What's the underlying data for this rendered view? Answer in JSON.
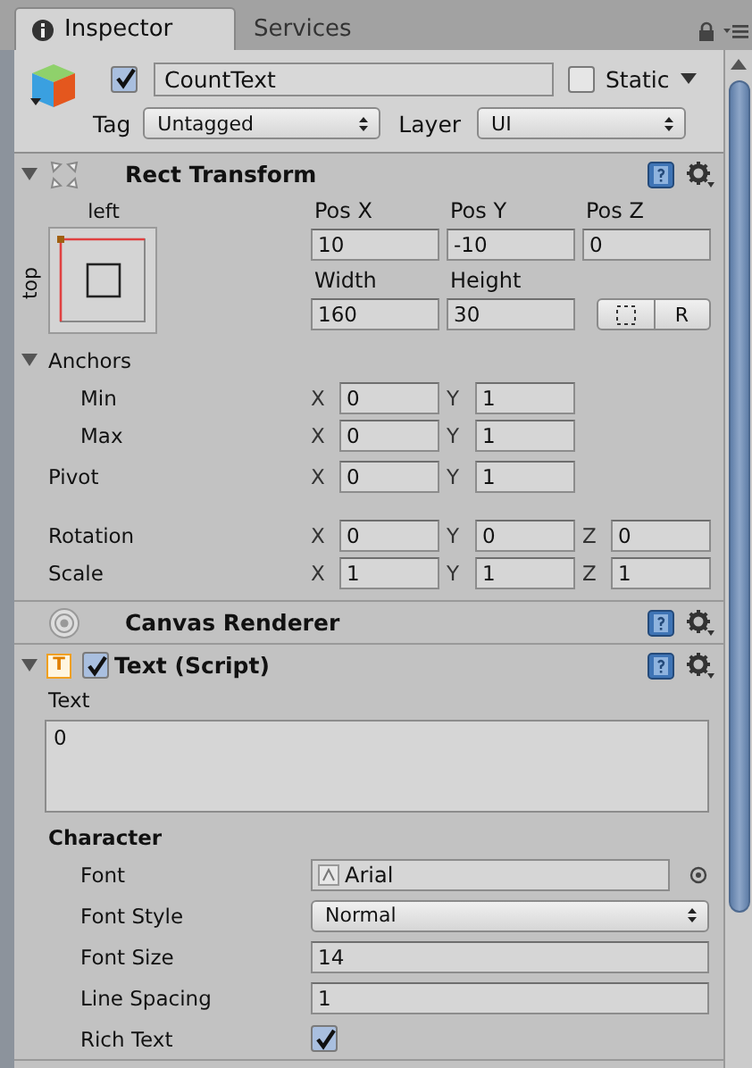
{
  "tabs": [
    {
      "label": "Inspector",
      "selected": true
    },
    {
      "label": "Services",
      "selected": false
    }
  ],
  "object": {
    "active": true,
    "name": "CountText",
    "static": false,
    "static_label": "Static",
    "tag_label": "Tag",
    "tag": "Untagged",
    "layer_label": "Layer",
    "layer": "UI"
  },
  "components": [
    {
      "kind": "rect_transform",
      "title": "Rect Transform",
      "expanded": true,
      "anchor_h": "left",
      "anchor_v": "top",
      "position_fields": [
        {
          "label": "Pos X",
          "value": "10"
        },
        {
          "label": "Pos Y",
          "value": "-10"
        },
        {
          "label": "Pos Z",
          "value": "0"
        }
      ],
      "size_fields": [
        {
          "label": "Width",
          "value": "160"
        },
        {
          "label": "Height",
          "value": "30"
        }
      ],
      "raw_button": "R",
      "anchors": {
        "label": "Anchors",
        "expanded": true,
        "rows": [
          {
            "label": "Min",
            "axes": [
              {
                "axis": "X",
                "value": "0"
              },
              {
                "axis": "Y",
                "value": "1"
              }
            ]
          },
          {
            "label": "Max",
            "axes": [
              {
                "axis": "X",
                "value": "0"
              },
              {
                "axis": "Y",
                "value": "1"
              }
            ]
          }
        ]
      },
      "groups": [
        {
          "rows": [
            {
              "label": "Pivot",
              "axes": [
                {
                  "axis": "X",
                  "value": "0"
                },
                {
                  "axis": "Y",
                  "value": "1"
                }
              ]
            }
          ]
        },
        {
          "rows": [
            {
              "label": "Rotation",
              "axes": [
                {
                  "axis": "X",
                  "value": "0"
                },
                {
                  "axis": "Y",
                  "value": "0"
                },
                {
                  "axis": "Z",
                  "value": "0"
                }
              ]
            },
            {
              "label": "Scale",
              "axes": [
                {
                  "axis": "X",
                  "value": "1"
                },
                {
                  "axis": "Y",
                  "value": "1"
                },
                {
                  "axis": "Z",
                  "value": "1"
                }
              ]
            }
          ]
        }
      ]
    },
    {
      "kind": "canvas_renderer",
      "title": "Canvas Renderer"
    },
    {
      "kind": "script",
      "title": "Text (Script)",
      "icon_glyph": "T",
      "expanded": true,
      "enabled": true,
      "text_label": "Text",
      "text_value": "0",
      "section": "Character",
      "properties": [
        {
          "kind": "object",
          "label": "Font",
          "value": "Arial"
        },
        {
          "kind": "dropdown",
          "label": "Font Style",
          "value": "Normal"
        },
        {
          "kind": "number",
          "label": "Font Size",
          "value": "14"
        },
        {
          "kind": "number",
          "label": "Line Spacing",
          "value": "1"
        },
        {
          "kind": "checkbox",
          "label": "Rich Text",
          "checked": true
        }
      ]
    }
  ]
}
